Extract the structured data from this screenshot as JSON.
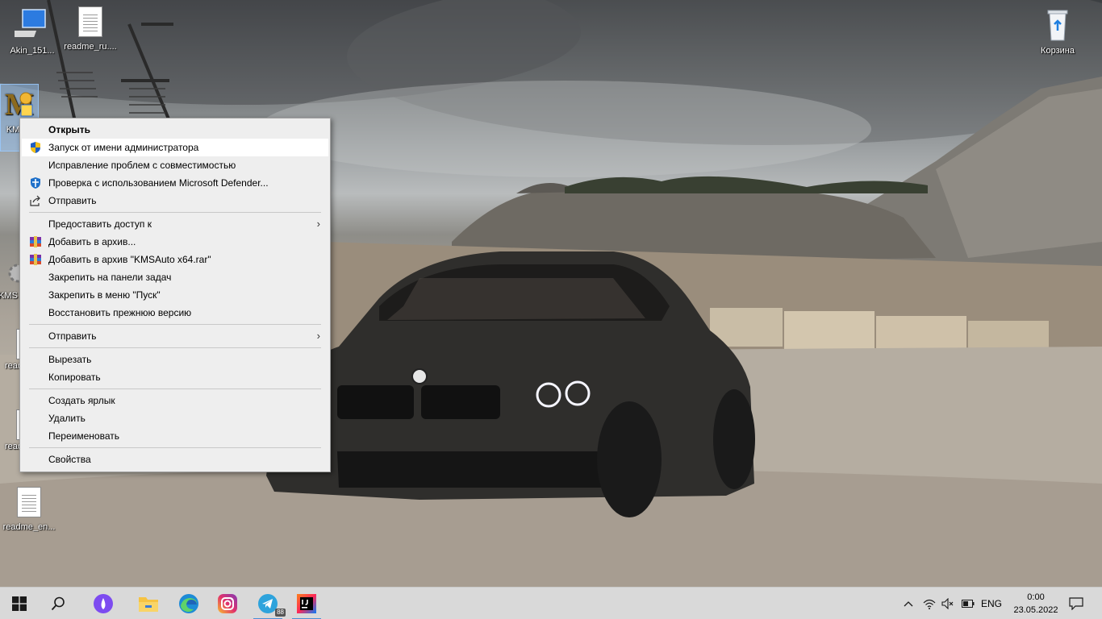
{
  "desktop": {
    "icons": [
      {
        "label": "Akin_151...",
        "icon": "computer-icon"
      },
      {
        "label": "readme_ru....",
        "icon": "text-file-icon"
      },
      {
        "label": "Корзина",
        "icon": "recycle-bin-icon"
      },
      {
        "label": "KMS x",
        "icon": "kmsauto-icon"
      },
      {
        "label": "KMS",
        "icon": "gear-icon"
      },
      {
        "label": "read",
        "icon": "text-file-icon"
      },
      {
        "label": "read",
        "icon": "text-file-icon"
      },
      {
        "label": "readme_en...",
        "icon": "text-file-icon"
      }
    ]
  },
  "context_menu": {
    "items": [
      {
        "label": "Открыть",
        "bold": true
      },
      {
        "label": "Запуск от имени администратора",
        "icon": "uac-shield-icon",
        "highlighted": true
      },
      {
        "label": "Исправление проблем с совместимостью"
      },
      {
        "label": "Проверка с использованием Microsoft Defender...",
        "icon": "defender-icon"
      },
      {
        "label": "Отправить",
        "icon": "share-icon"
      },
      {
        "label": "Предоставить доступ к",
        "submenu": true
      },
      {
        "label": "Добавить в архив...",
        "icon": "winrar-icon"
      },
      {
        "label": "Добавить в архив \"KMSAuto x64.rar\"",
        "icon": "winrar-icon"
      },
      {
        "label": "Закрепить на панели задач"
      },
      {
        "label": "Закрепить в меню \"Пуск\""
      },
      {
        "label": "Восстановить прежнюю версию"
      },
      {
        "label": "Отправить",
        "submenu": true
      },
      {
        "label": "Вырезать"
      },
      {
        "label": "Копировать"
      },
      {
        "label": "Создать ярлык"
      },
      {
        "label": "Удалить"
      },
      {
        "label": "Переименовать"
      },
      {
        "label": "Свойства"
      }
    ],
    "submenu_arrow": "›"
  },
  "taskbar": {
    "apps": [
      {
        "name": "start",
        "icon": "windows-logo-icon"
      },
      {
        "name": "search",
        "icon": "search-icon"
      },
      {
        "name": "alice",
        "icon": "alice-icon"
      },
      {
        "name": "explorer",
        "icon": "folder-icon"
      },
      {
        "name": "edge",
        "icon": "edge-icon"
      },
      {
        "name": "instagram",
        "icon": "instagram-icon"
      },
      {
        "name": "telegram",
        "icon": "telegram-icon",
        "badge": "88"
      },
      {
        "name": "intellij",
        "icon": "intellij-icon"
      }
    ],
    "tray": {
      "language": "ENG",
      "time": "0:00",
      "date": "23.05.2022"
    }
  }
}
